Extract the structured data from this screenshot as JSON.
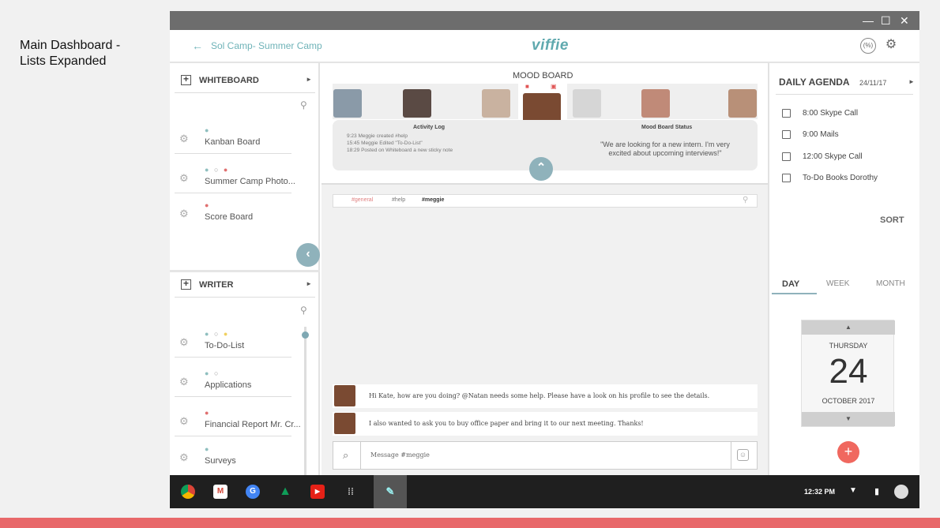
{
  "slide": {
    "title": "Main Dashboard -\nLists Expanded"
  },
  "window": {
    "minimize": "—",
    "maximize": "☐",
    "close": "✕"
  },
  "header": {
    "back": "←",
    "project": "Sol Camp- Summer Camp",
    "logo": "viffie",
    "icon1": "(%)",
    "icon2": "⚙"
  },
  "whiteboard": {
    "plus": "+",
    "label": "WHITEBOARD",
    "caret": "►",
    "search": "⚲",
    "items": [
      {
        "dots": "●",
        "label": "Kanban Board",
        "dot_colors": [
          "#8fbfbf"
        ]
      },
      {
        "dots": "● ○ ●",
        "label": "Summer Camp Photo...",
        "dot_colors": [
          "#8fbfbf",
          "#999",
          "#e07070"
        ]
      },
      {
        "dots": "●",
        "label": "Score Board",
        "dot_colors": [
          "#e07070"
        ]
      }
    ]
  },
  "writer": {
    "plus": "+",
    "label": "WRITER",
    "caret": "►",
    "search": "⚲",
    "items": [
      {
        "dots": "● ○ ●",
        "label": "To-Do-List"
      },
      {
        "dots": "● ○",
        "label": "Applications"
      },
      {
        "dots": "●",
        "label": "Financial Report Mr. Cr..."
      },
      {
        "dots": "●",
        "label": "Surveys"
      }
    ]
  },
  "collapse_left": "‹",
  "expand_right": "›",
  "mood_board": {
    "title": "MOOD BOARD",
    "activity_title": "Activity Log",
    "activity": [
      "9:23 Meggie created #help",
      "15:45 Meggie Edited \"To-Do-List\"",
      "18:29 Posted on Whiteboard a new sticky note"
    ],
    "status_title": "Mood Board Status",
    "status_quote": "\"We are looking for a new intern. I'm very excited about upcoming interviews!\"",
    "up": "⌃"
  },
  "chat": {
    "tags": [
      "#general",
      "#help",
      "#meggie"
    ],
    "search": "⚲",
    "messages": [
      "Hi Kate, how are you doing? @Natan needs some help. Please have a look on his profile to see the details.",
      "I also wanted to ask you to buy office paper and bring it to our next meeting. Thanks!"
    ],
    "placeholder": "Message #meggie",
    "clip": "⊘",
    "emoji": "☺"
  },
  "agenda": {
    "title": "DAILY AGENDA",
    "date": "24/11/17",
    "caret": "►",
    "items": [
      "8:00 Skype Call",
      "9:00 Mails",
      "12:00 Skype Call",
      "To-Do Books Dorothy"
    ],
    "sort": "SORT",
    "tabs": [
      "DAY",
      "WEEK",
      "MONTH"
    ],
    "calendar": {
      "up": "▲",
      "weekday": "THURSDAY",
      "day": "24",
      "month": "OCTOBER 2017",
      "down": "▼"
    },
    "add": "+"
  },
  "taskbar": {
    "clock": "12:32 PM",
    "wifi": "▼",
    "battery": "▮"
  }
}
